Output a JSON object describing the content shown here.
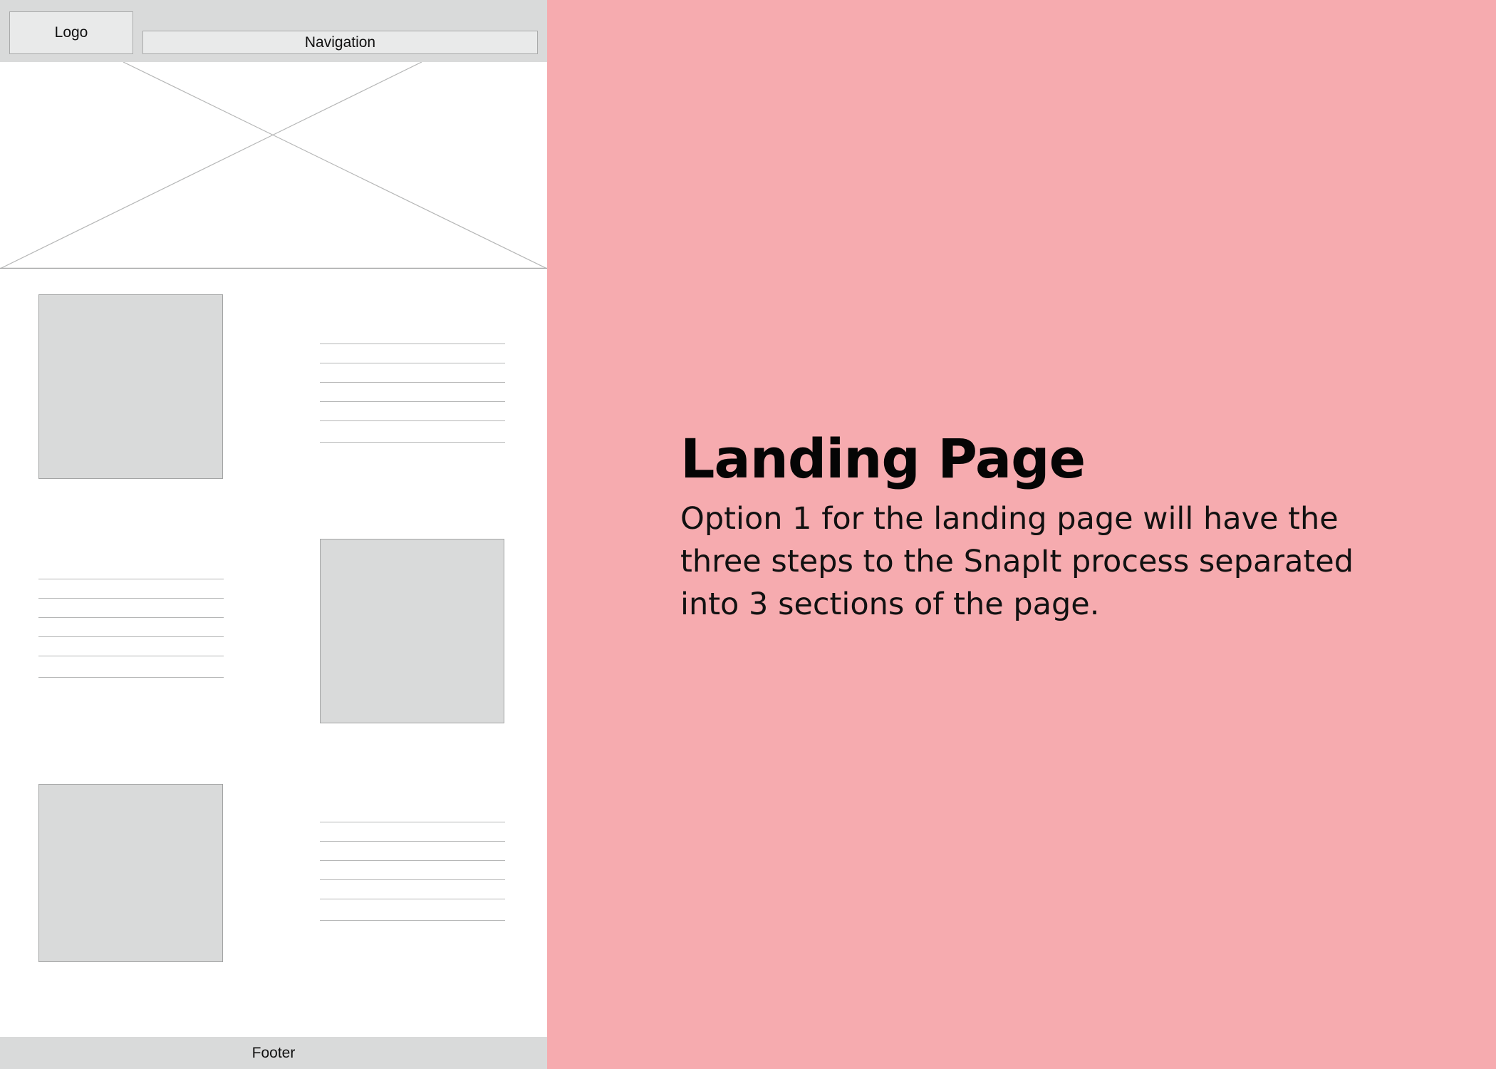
{
  "wireframe": {
    "logo_label": "Logo",
    "nav_label": "Navigation",
    "footer_label": "Footer",
    "sections": [
      {
        "image_side": "left",
        "text_lines": 6
      },
      {
        "image_side": "right",
        "text_lines": 6
      },
      {
        "image_side": "left",
        "text_lines": 6
      }
    ]
  },
  "description": {
    "title": "Landing Page",
    "body": "Option 1 for the landing page will have the three steps to the SnapIt process separated into 3 sections of the page."
  },
  "colors": {
    "background_panel": "#f6abaf",
    "wireframe_gray": "#d9dada",
    "text": "#050505"
  }
}
